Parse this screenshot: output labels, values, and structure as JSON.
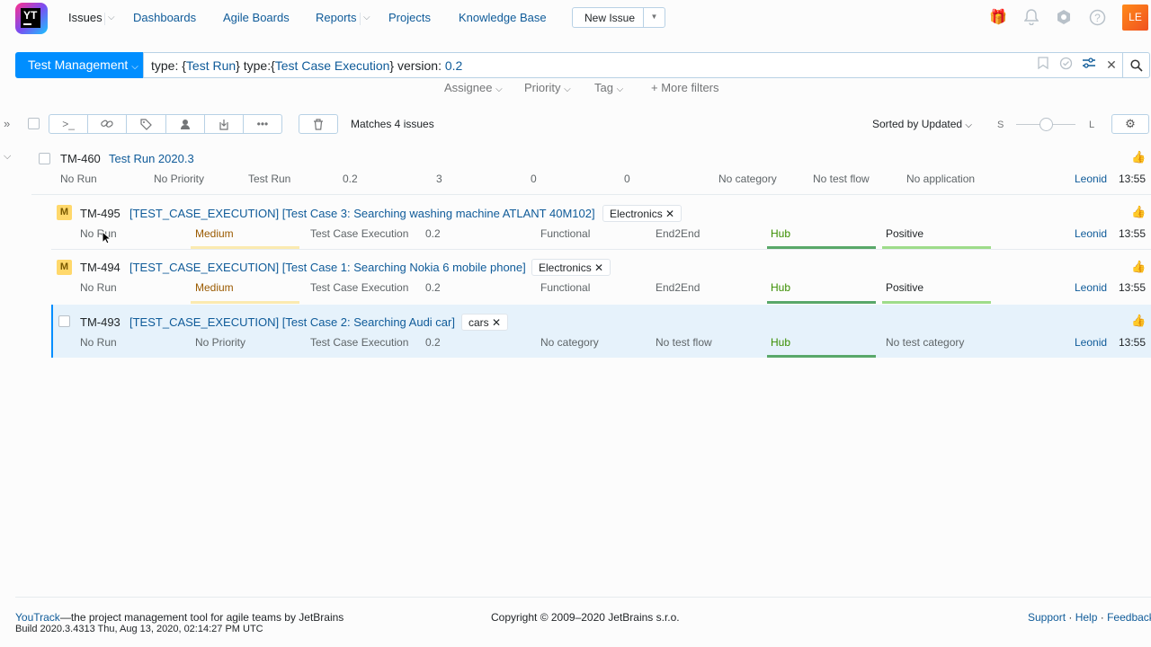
{
  "header": {
    "logo_text": "YT",
    "nav": {
      "issues": "Issues",
      "dashboards": "Dashboards",
      "agile_boards": "Agile Boards",
      "reports": "Reports",
      "projects": "Projects",
      "knowledge_base": "Knowledge Base"
    },
    "new_issue": "New Issue",
    "avatar": "LE",
    "icons": [
      "gift-icon",
      "bell-icon",
      "hub-icon",
      "help-icon"
    ]
  },
  "search": {
    "context": "Test Management",
    "query_parts": {
      "p1": "type: {",
      "p2": "Test Run",
      "p3": "} type:{",
      "p4": "Test Case Execution",
      "p5": "}  version: ",
      "p6": "0.2"
    }
  },
  "filters": {
    "assignee": "Assignee",
    "priority": "Priority",
    "tag": "Tag",
    "more": "More filters"
  },
  "toolbar": {
    "matches": "Matches 4 issues",
    "sort": "Sorted by Updated",
    "size_small": "S",
    "size_large": "L"
  },
  "issues": [
    {
      "id": "TM-460",
      "summary": "Test Run 2020.3",
      "fields": [
        "No Run",
        "No Priority",
        "Test Run",
        "0.2",
        "3",
        "0",
        "0",
        "No category",
        "No test flow",
        "No application"
      ],
      "assignee": "Leonid",
      "time": "13:55"
    },
    {
      "id": "TM-495",
      "badge": "M",
      "summary": "[TEST_CASE_EXECUTION] [Test Case 3: Searching washing machine ATLANT 40M102]",
      "tag": "Electronics",
      "fields": [
        "No Run",
        "Medium",
        "Test Case Execution",
        "0.2",
        "Functional",
        "End2End",
        "Hub",
        "Positive"
      ],
      "assignee": "Leonid",
      "time": "13:55"
    },
    {
      "id": "TM-494",
      "badge": "M",
      "summary": "[TEST_CASE_EXECUTION] [Test Case 1: Searching Nokia 6 mobile phone]",
      "tag": "Electronics",
      "fields": [
        "No Run",
        "Medium",
        "Test Case Execution",
        "0.2",
        "Functional",
        "End2End",
        "Hub",
        "Positive"
      ],
      "assignee": "Leonid",
      "time": "13:55"
    },
    {
      "id": "TM-493",
      "summary": "[TEST_CASE_EXECUTION] [Test Case 2: Searching Audi car]",
      "tag": "cars",
      "fields": [
        "No Run",
        "No Priority",
        "Test Case Execution",
        "0.2",
        "No category",
        "No test flow",
        "Hub",
        "No test category"
      ],
      "assignee": "Leonid",
      "time": "13:55"
    }
  ],
  "colors": {
    "accent": "#008eff",
    "link": "#0f5b99",
    "medium": "#ffd86b",
    "hub": "#59a869",
    "positive": "#8fd47a"
  },
  "footer": {
    "youtrack": "YouTrack",
    "tagline": "—the project management tool for agile teams by JetBrains",
    "build": "Build 2020.3.4313 Thu, Aug 13, 2020, 02:14:27 PM UTC",
    "copyright": "Copyright © 2009–2020 JetBrains s.r.o.",
    "support": "Support",
    "help": "Help",
    "feedback": "Feedback",
    "sep": "·"
  }
}
